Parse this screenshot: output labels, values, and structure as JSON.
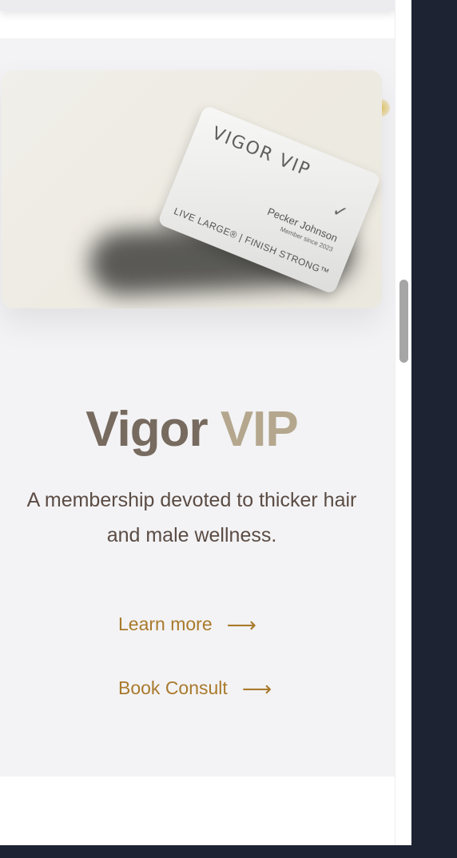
{
  "card": {
    "brand": "VIGOR VIP",
    "check_icon": "checkmark-icon",
    "holder_name": "Pecker Johnson",
    "member_since": "Member since 2023",
    "tagline": "LIVE LARGE® | FINISH STRONG™"
  },
  "section": {
    "title_part1": "Vigor",
    "title_part2": "VIP",
    "description": "A membership devoted to thicker hair and male wellness.",
    "cta_learn": "Learn more",
    "cta_book": "Book Consult",
    "arrow": "⟶"
  },
  "colors": {
    "accent_gold": "#a97a2c",
    "title_dark": "#776a5f",
    "title_light": "#b4a78e",
    "page_dark": "#1d2332"
  }
}
